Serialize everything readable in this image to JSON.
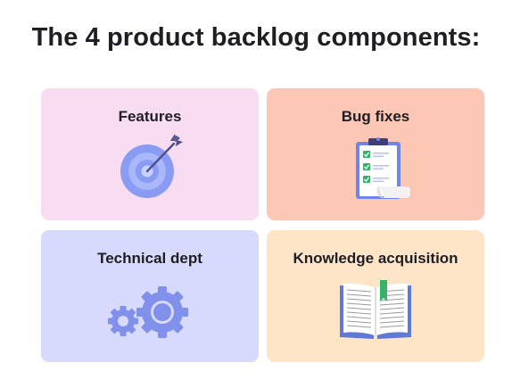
{
  "page": {
    "title": "The 4 product backlog components:"
  },
  "cards": [
    {
      "label": "Features",
      "icon": "target-icon",
      "color": "#f8dcf1"
    },
    {
      "label": "Bug fixes",
      "icon": "checklist-clipboard-icon",
      "color": "#fdc7b6"
    },
    {
      "label": "Technical dept",
      "icon": "gears-icon",
      "color": "#d8dafd"
    },
    {
      "label": "Knowledge acquisition",
      "icon": "open-book-icon",
      "color": "#ffe5c8"
    }
  ]
}
